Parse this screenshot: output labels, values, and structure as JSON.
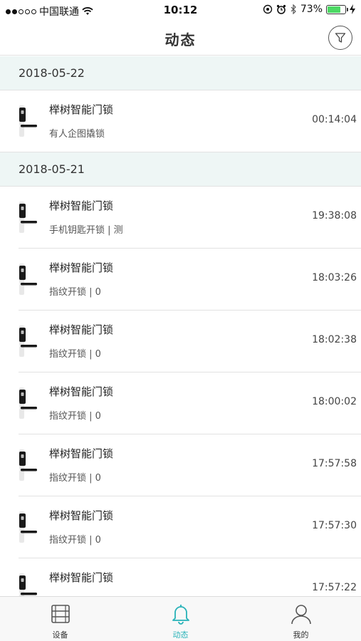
{
  "status_bar": {
    "carrier": "中国联通",
    "time": "10:12",
    "battery": "73%",
    "battery_level": 0.73,
    "icons": [
      "signal-dots",
      "wifi-icon",
      "location-icon",
      "alarm-icon",
      "bluetooth-icon",
      "battery-icon",
      "charging-icon"
    ]
  },
  "nav": {
    "title": "动态",
    "filter_icon": "filter-icon"
  },
  "groups": [
    {
      "date": "2018-05-22",
      "items": [
        {
          "title": "榉树智能门锁",
          "subtitle": "有人企图撬锁",
          "time": "00:14:04"
        }
      ]
    },
    {
      "date": "2018-05-21",
      "items": [
        {
          "title": "榉树智能门锁",
          "subtitle": "手机钥匙开锁 | 测",
          "time": "19:38:08"
        },
        {
          "title": "榉树智能门锁",
          "subtitle": "指纹开锁 | 0",
          "time": "18:03:26"
        },
        {
          "title": "榉树智能门锁",
          "subtitle": "指纹开锁 | 0",
          "time": "18:02:38"
        },
        {
          "title": "榉树智能门锁",
          "subtitle": "指纹开锁 | 0",
          "time": "18:00:02"
        },
        {
          "title": "榉树智能门锁",
          "subtitle": "指纹开锁 | 0",
          "time": "17:57:58"
        },
        {
          "title": "榉树智能门锁",
          "subtitle": "指纹开锁 | 0",
          "time": "17:57:30"
        },
        {
          "title": "榉树智能门锁",
          "subtitle": "",
          "time": "17:57:22"
        }
      ]
    }
  ],
  "tab_bar": {
    "tabs": [
      {
        "label": "设备",
        "icon": "device-icon",
        "active": false
      },
      {
        "label": "动态",
        "icon": "bell-icon",
        "active": true
      },
      {
        "label": "我的",
        "icon": "user-icon",
        "active": false
      }
    ],
    "active_color": "#27b2b8"
  },
  "colors": {
    "date_header_bg": "#eef6f5",
    "accent": "#27b2b8",
    "battery": "#4cd964"
  }
}
